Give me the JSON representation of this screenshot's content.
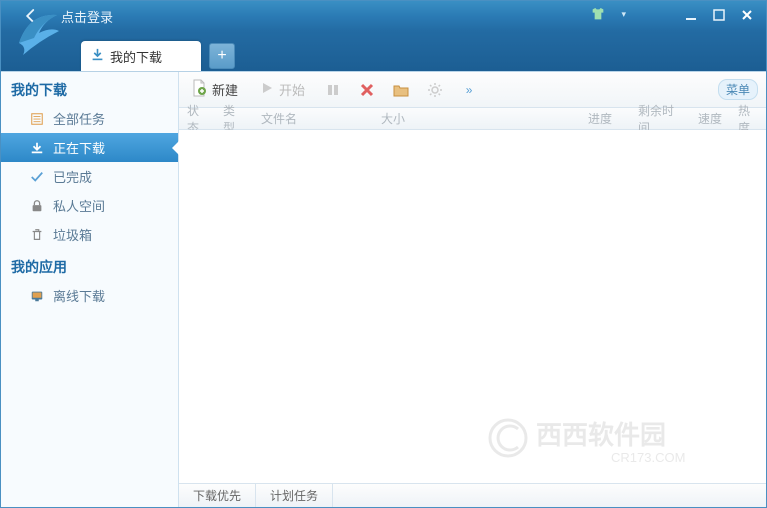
{
  "title": {
    "login_text": "点击登录"
  },
  "tab": {
    "label": "我的下载"
  },
  "sidebar": {
    "section_downloads": "我的下载",
    "items_dl": [
      {
        "icon": "list-icon",
        "label": "全部任务"
      },
      {
        "icon": "download-icon",
        "label": "正在下载"
      },
      {
        "icon": "check-icon",
        "label": "已完成"
      },
      {
        "icon": "lock-icon",
        "label": "私人空间"
      },
      {
        "icon": "trash-icon",
        "label": "垃圾箱"
      }
    ],
    "section_apps": "我的应用",
    "items_app": [
      {
        "icon": "offline-icon",
        "label": "离线下载"
      }
    ]
  },
  "toolbar": {
    "new_label": "新建",
    "start_label": "开始",
    "menu_label": "菜单"
  },
  "columns": {
    "status": "状态",
    "type": "类型",
    "name": "文件名",
    "size": "大小",
    "progress": "进度",
    "remain": "剩余时间",
    "speed": "速度",
    "heat": "热度"
  },
  "statusbar": {
    "priority": "下载优先",
    "plan": "计划任务"
  },
  "watermark": {
    "text": "西西软件园",
    "domain": "CR173.COM"
  }
}
